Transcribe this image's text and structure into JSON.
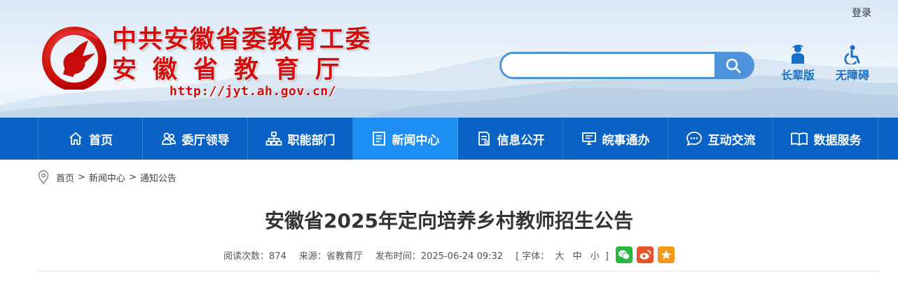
{
  "header": {
    "login_label": "登录",
    "site_name_line1": "中共安徽省委教育工委",
    "site_name_line2": "安徽省教育厅",
    "site_url": "http://jyt.ah.gov.cn/",
    "search_placeholder": "",
    "elder_label": "长辈版",
    "accessible_label": "无障碍"
  },
  "nav": {
    "items": [
      {
        "label": "首页",
        "icon": "home-icon"
      },
      {
        "label": "委厅领导",
        "icon": "users-icon"
      },
      {
        "label": "职能部门",
        "icon": "org-chart-icon"
      },
      {
        "label": "新闻中心",
        "icon": "news-icon",
        "active": true
      },
      {
        "label": "信息公开",
        "icon": "document-icon"
      },
      {
        "label": "皖事通办",
        "icon": "monitor-icon"
      },
      {
        "label": "互动交流",
        "icon": "chat-icon"
      },
      {
        "label": "数据服务",
        "icon": "book-icon"
      }
    ]
  },
  "breadcrumb": {
    "home": "首页",
    "section": "新闻中心",
    "current": "通知公告",
    "separator": ">"
  },
  "article": {
    "title": "安徽省2025年定向培养乡村教师招生公告",
    "views_label": "阅读次数：",
    "views": "874",
    "source_label": "来源：",
    "source": "省教育厅",
    "date_label": "发布时间：",
    "date": "2025-06-24 09:32",
    "font_size_open": "[ 字体：",
    "font_large": "大",
    "font_medium": "中",
    "font_small": "小",
    "font_size_close": "]"
  },
  "colors": {
    "brand_red": "#d50c0c",
    "nav_blue": "#0a63c4",
    "nav_active": "#1f8ef2",
    "accent_blue": "#1a6fc4",
    "wechat_green": "#2db542",
    "weibo_orange": "#e6552a",
    "favorite_orange": "#f29a1a"
  }
}
